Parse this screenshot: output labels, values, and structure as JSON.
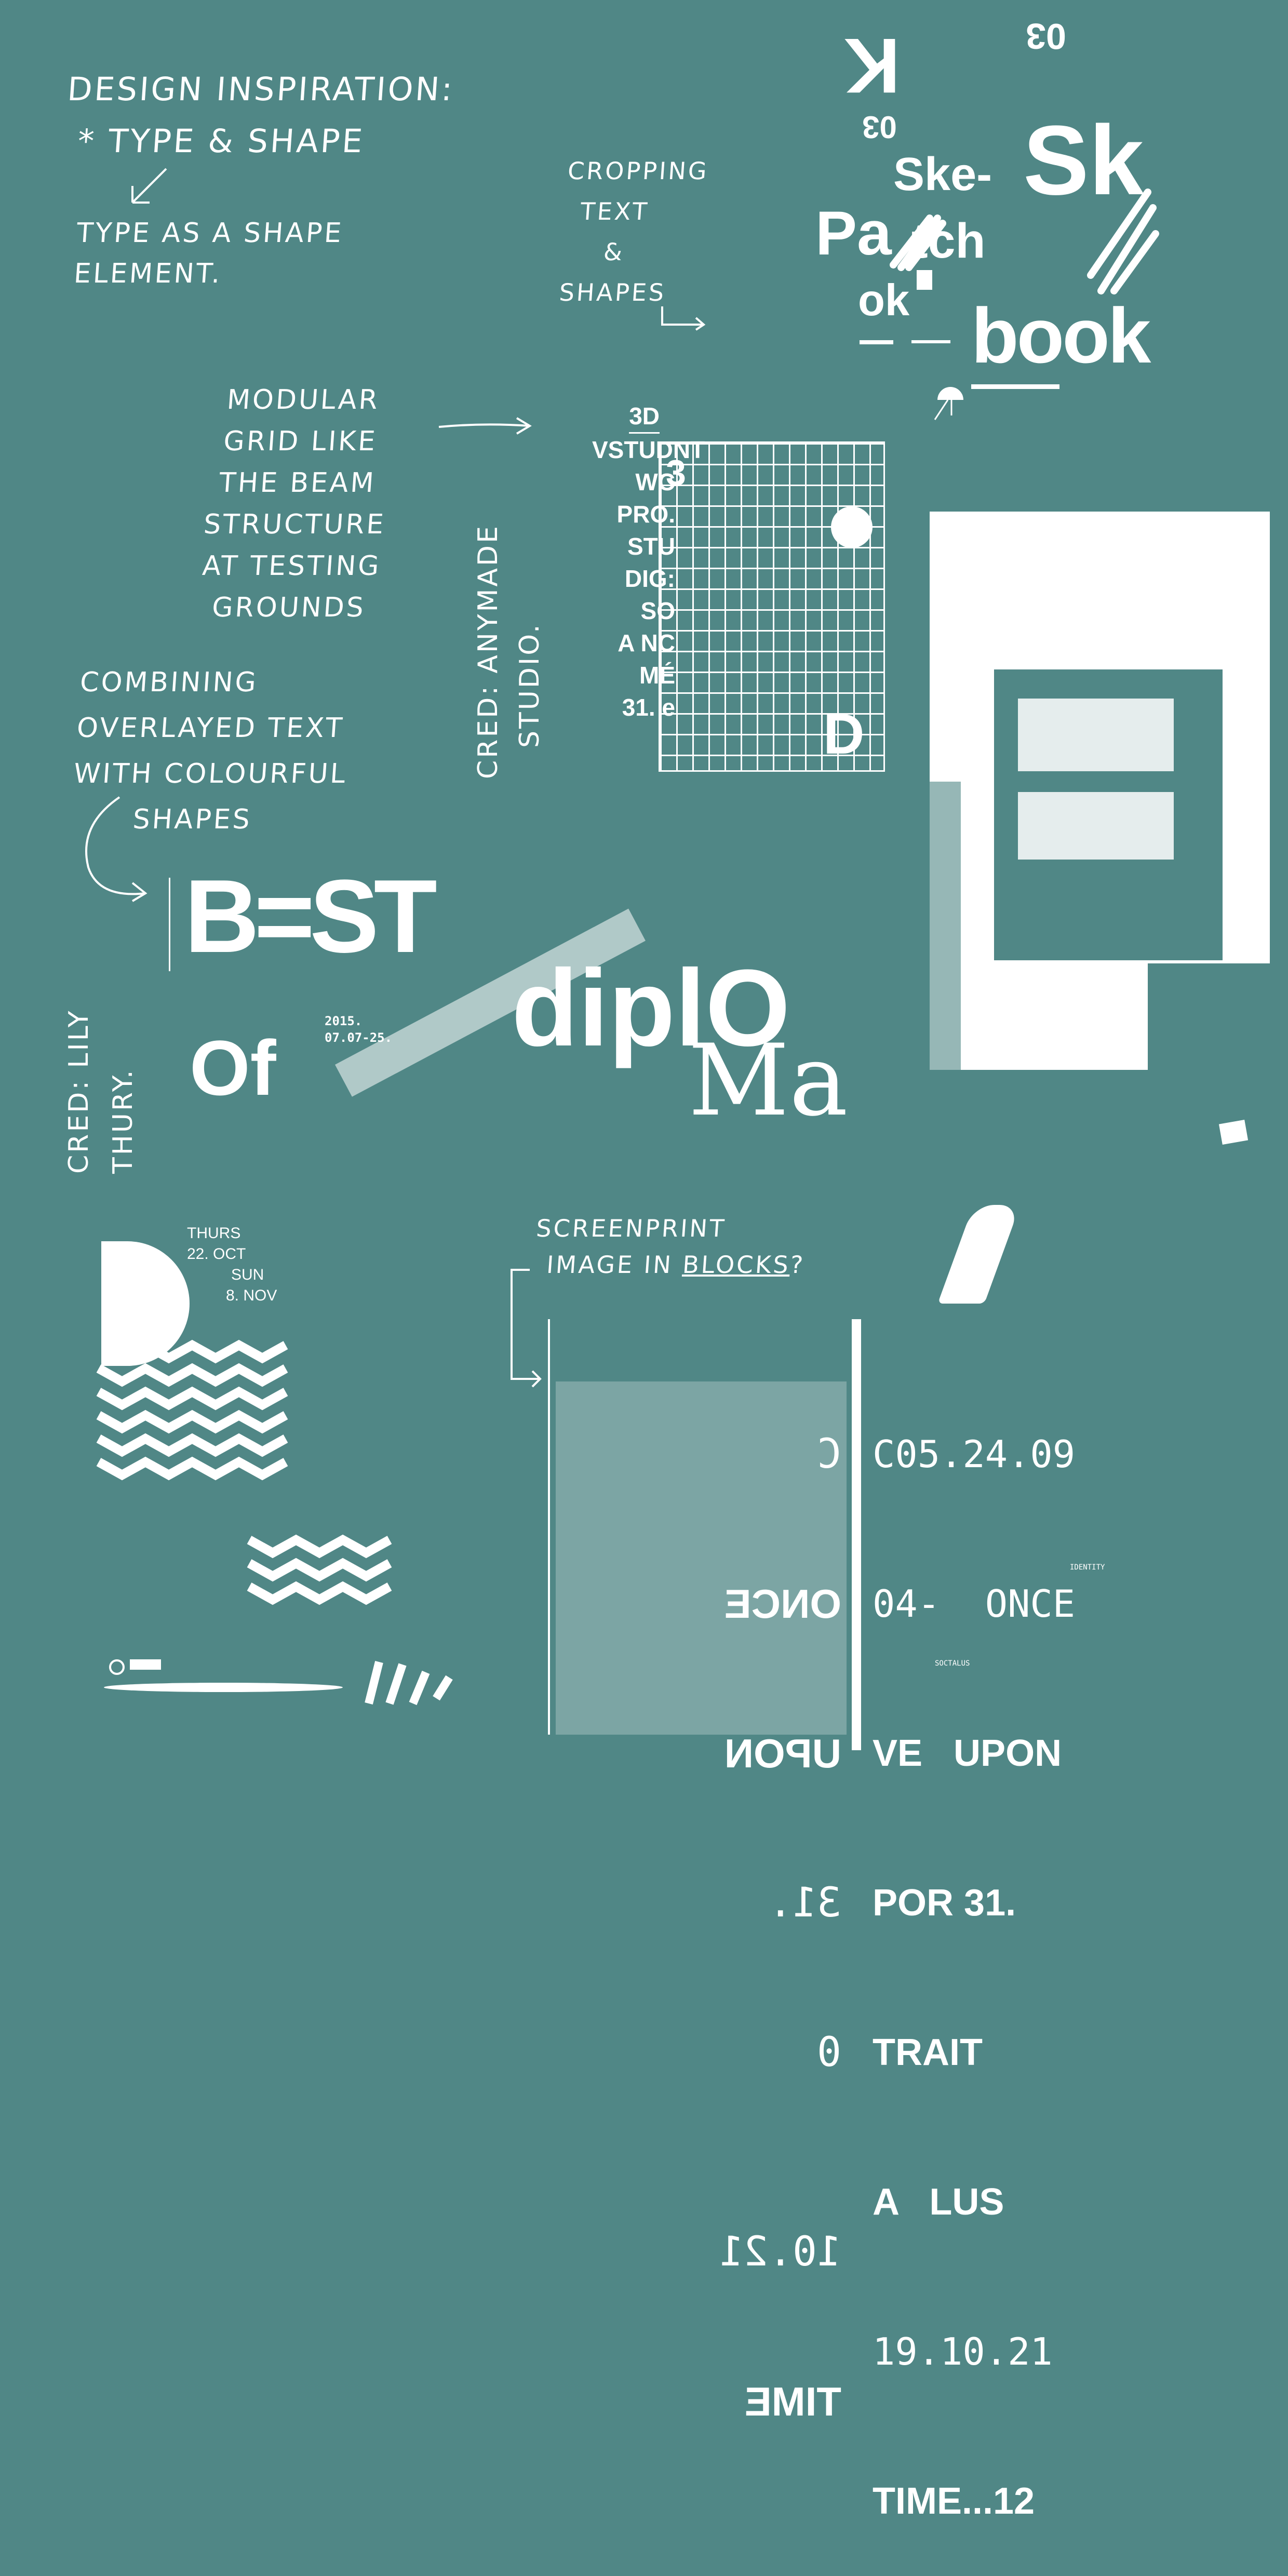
{
  "background_color": "#508786",
  "ink_color": "#ffffff",
  "notes": {
    "heading": "Design inspiration:",
    "bullet": "* Type & shape",
    "type_as_shape": [
      "Type as a shape",
      "element."
    ],
    "cropping": [
      "Cropping",
      "text",
      "&",
      "shapes"
    ],
    "modular": [
      "Modular",
      "grid like",
      "the beam",
      "structure",
      "at testing",
      "grounds"
    ],
    "combining": [
      "Combining",
      "overlayed text",
      "with colourful",
      "shapes"
    ],
    "credit_anymade": [
      "Cred: Anymade",
      "studio."
    ],
    "credit_lily": [
      "Cred: Lily",
      "Thury."
    ],
    "screenprint": [
      "Screenprint",
      "image in",
      "blocks",
      "?"
    ]
  },
  "sketchbook_poster": {
    "letters": [
      "K",
      "03",
      "Ske-",
      "Pa",
      "tch",
      "ok",
      "Sk",
      "book",
      "03"
    ]
  },
  "grid_poster": {
    "side_text": [
      "3D",
      "VSTUDNT",
      "WC",
      "PRO.",
      "STU",
      "DIG:",
      "SO",
      "A NC",
      "MÉ",
      "31. e"
    ],
    "grid_labels": [
      "3",
      "D"
    ]
  },
  "diploma_poster": {
    "words": [
      "B=ST",
      "diplO",
      "Ma",
      "Of"
    ],
    "date_lines": [
      "2015.",
      "07.07-25."
    ]
  },
  "sea_poster": {
    "dates": [
      "THURS",
      "22. OCT",
      "SUN",
      "8. NOV"
    ]
  },
  "screenprint_poster": {
    "left_column": [
      "C",
      "ONCE",
      "UPON",
      "31.",
      "0",
      "10.21",
      "TIME"
    ],
    "right_column": [
      "C05.24.09",
      "04-  ONCE",
      "VE   UPON",
      "POR 31.",
      "TRAIT",
      "A   LUS",
      "19.10.21",
      "TIME...12"
    ],
    "small_labels": [
      "IDENTITY",
      "SOCTALUS"
    ]
  }
}
